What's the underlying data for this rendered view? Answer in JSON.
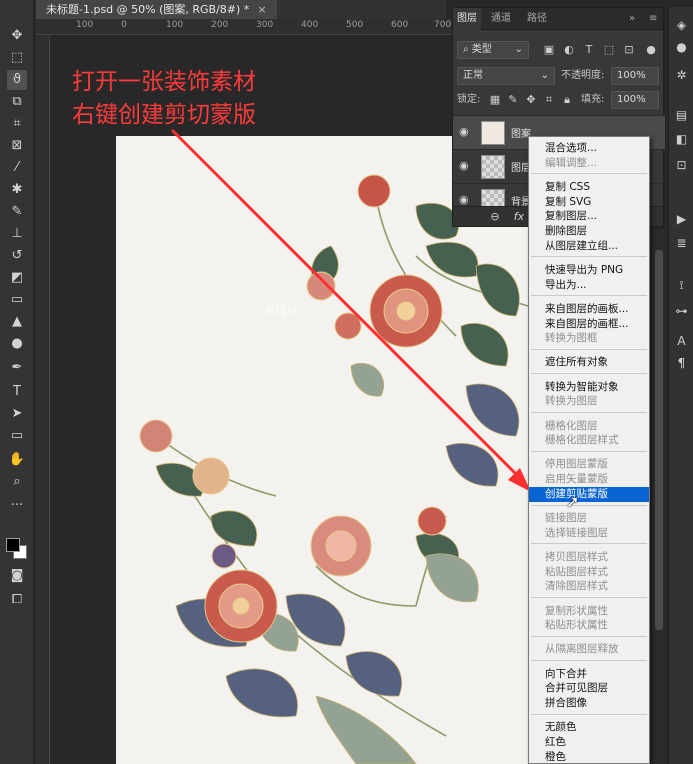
{
  "document_tab": {
    "title": "未标题-1.psd @ 50% (图案, RGB/8#) *",
    "close": "×"
  },
  "ruler": {
    "ticks": [
      "100",
      "0",
      "100",
      "200",
      "300",
      "400",
      "500",
      "600",
      "700"
    ]
  },
  "annotation": {
    "line1": "打开一张装饰素材",
    "line2": "右键创建剪切蒙版"
  },
  "watermark": "术设计",
  "layers_panel": {
    "tabs": [
      "图层",
      "通道",
      "路径"
    ],
    "filter_label": "类型",
    "blend_mode": "正常",
    "opacity_label": "不透明度:",
    "opacity_value": "100%",
    "lock_label": "锁定:",
    "fill_label": "填充:",
    "fill_value": "100%",
    "layers": [
      {
        "name": "图案",
        "selected": true
      },
      {
        "name": "图层",
        "selected": false
      },
      {
        "name": "背景",
        "selected": false
      }
    ],
    "footer": {
      "link": "⊖",
      "fx": "fx"
    }
  },
  "context_menu": {
    "groups": [
      [
        {
          "label": "混合选项...",
          "enabled": true
        },
        {
          "label": "编辑调整...",
          "enabled": false
        }
      ],
      [
        {
          "label": "复制 CSS",
          "enabled": true
        },
        {
          "label": "复制 SVG",
          "enabled": true
        },
        {
          "label": "复制图层...",
          "enabled": true
        },
        {
          "label": "删除图层",
          "enabled": true
        },
        {
          "label": "从图层建立组...",
          "enabled": true
        }
      ],
      [
        {
          "label": "快速导出为 PNG",
          "enabled": true
        },
        {
          "label": "导出为...",
          "enabled": true
        }
      ],
      [
        {
          "label": "来自图层的画板...",
          "enabled": true
        },
        {
          "label": "来自图层的画框...",
          "enabled": true
        },
        {
          "label": "转换为图框",
          "enabled": false
        }
      ],
      [
        {
          "label": "遮住所有对象",
          "enabled": true
        }
      ],
      [
        {
          "label": "转换为智能对象",
          "enabled": true
        },
        {
          "label": "转换为图层",
          "enabled": false
        }
      ],
      [
        {
          "label": "栅格化图层",
          "enabled": false
        },
        {
          "label": "栅格化图层样式",
          "enabled": false
        }
      ],
      [
        {
          "label": "停用图层蒙版",
          "enabled": false
        },
        {
          "label": "启用矢量蒙版",
          "enabled": false
        },
        {
          "label": "创建剪贴蒙版",
          "enabled": true,
          "highlighted": true
        }
      ],
      [
        {
          "label": "链接图层",
          "enabled": false
        },
        {
          "label": "选择链接图层",
          "enabled": false
        }
      ],
      [
        {
          "label": "拷贝图层样式",
          "enabled": false
        },
        {
          "label": "粘贴图层样式",
          "enabled": false
        },
        {
          "label": "清除图层样式",
          "enabled": false
        }
      ],
      [
        {
          "label": "复制形状属性",
          "enabled": false
        },
        {
          "label": "粘贴形状属性",
          "enabled": false
        }
      ],
      [
        {
          "label": "从隔离图层释放",
          "enabled": false
        }
      ],
      [
        {
          "label": "向下合并",
          "enabled": true
        },
        {
          "label": "合并可见图层",
          "enabled": true
        },
        {
          "label": "拼合图像",
          "enabled": true
        }
      ],
      [
        {
          "label": "无颜色",
          "enabled": true
        },
        {
          "label": "红色",
          "enabled": true
        },
        {
          "label": "橙色",
          "enabled": true
        }
      ]
    ]
  },
  "colors": {
    "ui_background": "#282828",
    "panel": "#383838",
    "menu_background": "#f0f0f0",
    "menu_highlight": "#0a64d2",
    "annotation_text": "#ff3b3b",
    "arrow": "#ff3030",
    "canvas": "#f4f2ee",
    "flower_red": "#c9574c",
    "leaf_green": "#44604f",
    "leaf_blue": "#4f5d7d"
  },
  "icons": {
    "toolbar": [
      "move-icon",
      "marquee-icon",
      "lasso-icon",
      "object-select-icon",
      "crop-icon",
      "frame-icon",
      "eyedropper-icon",
      "healing-icon",
      "brush-icon",
      "stamp-icon",
      "history-brush-icon",
      "eraser-icon",
      "gradient-icon",
      "blur-icon",
      "dodge-icon",
      "pen-icon",
      "type-icon",
      "path-select-icon",
      "shape-icon",
      "hand-icon",
      "zoom-icon",
      "more-icon"
    ],
    "dock": [
      "layers-icon",
      "color-icon",
      "adjust-icon",
      "library-icon",
      "properties-icon",
      "actions-icon",
      "history-icon",
      "brush-settings-icon",
      "character-icon",
      "paragraph-icon"
    ]
  }
}
